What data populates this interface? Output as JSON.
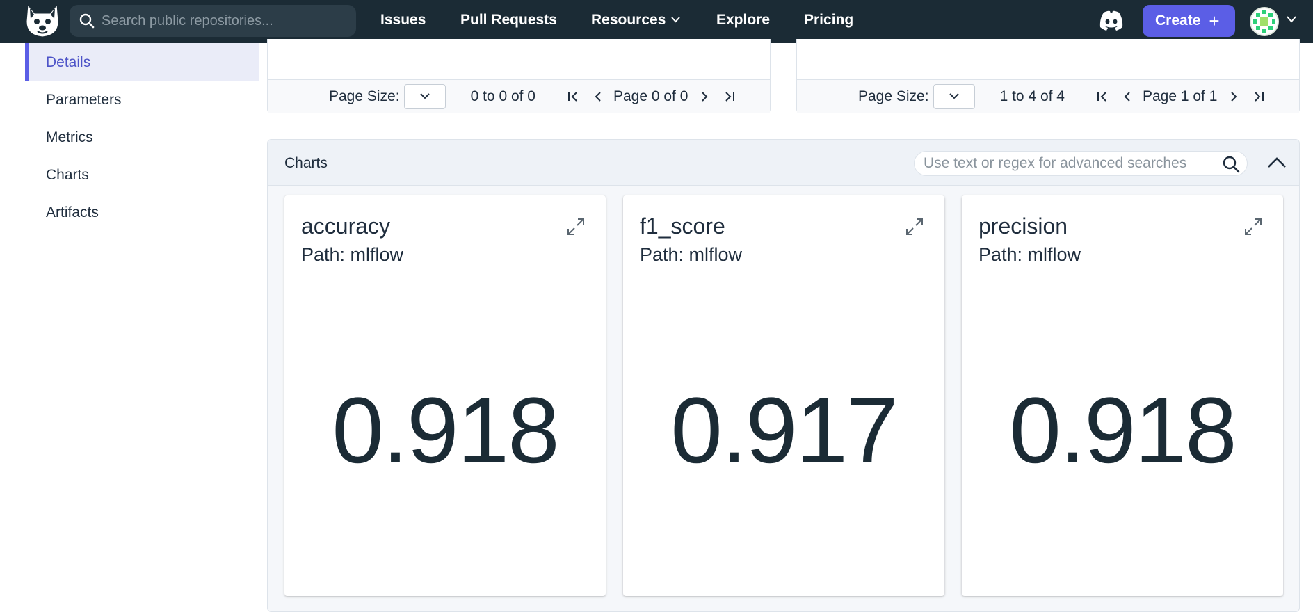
{
  "topbar": {
    "search_placeholder": "Search public repositories...",
    "nav": [
      "Issues",
      "Pull Requests",
      "Resources",
      "Explore",
      "Pricing"
    ],
    "create_label": "Create",
    "create_icon": "+"
  },
  "sidebar": {
    "items": [
      {
        "label": "Details",
        "active": true
      },
      {
        "label": "Parameters"
      },
      {
        "label": "Metrics"
      },
      {
        "label": "Charts"
      },
      {
        "label": "Artifacts"
      }
    ]
  },
  "tables": [
    {
      "page_size_label": "Page Size:",
      "range": "0 to 0 of 0",
      "page": "Page 0 of 0"
    },
    {
      "page_size_label": "Page Size:",
      "range": "1 to 4 of 4",
      "page": "Page 1 of 1"
    }
  ],
  "charts": {
    "title": "Charts",
    "search_placeholder": "Use text or regex for advanced searches",
    "cards": [
      {
        "name": "accuracy",
        "path": "Path: mlflow",
        "value": "0.918"
      },
      {
        "name": "f1_score",
        "path": "Path: mlflow",
        "value": "0.917"
      },
      {
        "name": "precision",
        "path": "Path: mlflow",
        "value": "0.918"
      }
    ]
  },
  "colors": {
    "nav_bg": "#1b2b35",
    "accent": "#5b5ee6",
    "active_bg": "#eaecf8"
  }
}
